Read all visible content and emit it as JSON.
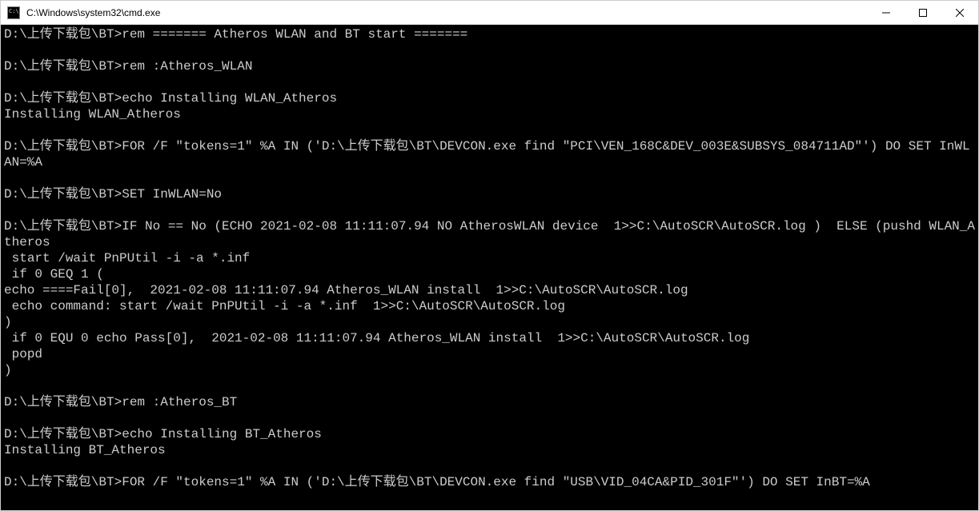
{
  "window": {
    "title": "C:\\Windows\\system32\\cmd.exe"
  },
  "console": {
    "lines": [
      "D:\\上传下载包\\BT>rem ======= Atheros WLAN and BT start =======",
      "",
      "D:\\上传下载包\\BT>rem :Atheros_WLAN",
      "",
      "D:\\上传下载包\\BT>echo Installing WLAN_Atheros",
      "Installing WLAN_Atheros",
      "",
      "D:\\上传下载包\\BT>FOR /F \"tokens=1\" %A IN ('D:\\上传下载包\\BT\\DEVCON.exe find \"PCI\\VEN_168C&DEV_003E&SUBSYS_084711AD\"') DO SET InWLAN=%A",
      "",
      "D:\\上传下载包\\BT>SET InWLAN=No",
      "",
      "D:\\上传下载包\\BT>IF No == No (ECHO 2021-02-08 11:11:07.94 NO AtherosWLAN device  1>>C:\\AutoSCR\\AutoSCR.log )  ELSE (pushd WLAN_Atheros",
      " start /wait PnPUtil -i -a *.inf",
      " if 0 GEQ 1 (",
      "echo ====Fail[0],  2021-02-08 11:11:07.94 Atheros_WLAN install  1>>C:\\AutoSCR\\AutoSCR.log",
      " echo command: start /wait PnPUtil -i -a *.inf  1>>C:\\AutoSCR\\AutoSCR.log",
      ")",
      " if 0 EQU 0 echo Pass[0],  2021-02-08 11:11:07.94 Atheros_WLAN install  1>>C:\\AutoSCR\\AutoSCR.log",
      " popd",
      ")",
      "",
      "D:\\上传下载包\\BT>rem :Atheros_BT",
      "",
      "D:\\上传下载包\\BT>echo Installing BT_Atheros",
      "Installing BT_Atheros",
      "",
      "D:\\上传下载包\\BT>FOR /F \"tokens=1\" %A IN ('D:\\上传下载包\\BT\\DEVCON.exe find \"USB\\VID_04CA&PID_301F\"') DO SET InBT=%A"
    ]
  }
}
